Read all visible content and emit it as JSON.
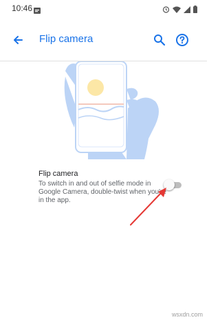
{
  "status_bar": {
    "time": "10:46"
  },
  "app_bar": {
    "title": "Flip camera"
  },
  "setting": {
    "title": "Flip camera",
    "description": "To switch in and out of selfie mode in Google Camera, double-twist when you're in the app.",
    "toggle_state": "off"
  },
  "watermark": "wsxdn.com",
  "colors": {
    "accent": "#1a73e8",
    "arrow": "#e53935",
    "illustration_blue": "#bcd4f6"
  }
}
